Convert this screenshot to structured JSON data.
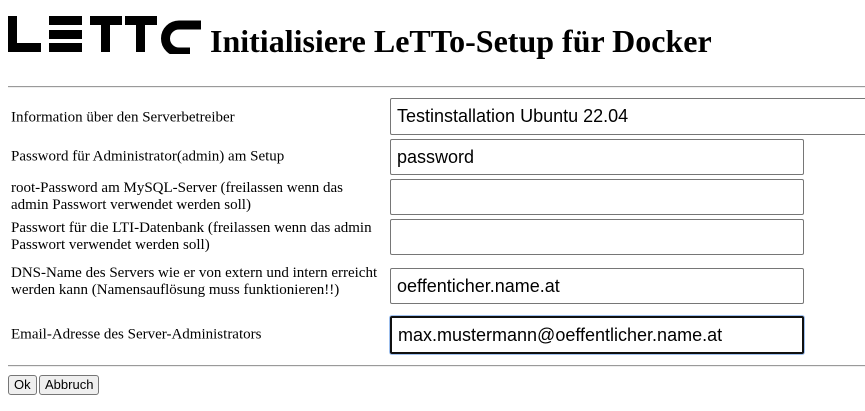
{
  "header": {
    "logo_text": "LeTTo",
    "title": "Initialisiere LeTTo-Setup für Docker"
  },
  "form": {
    "rows": [
      {
        "label": "Information über den Serverbetreiber",
        "value": "Testinstallation Ubuntu 22.04"
      },
      {
        "label": "Password für Administrator(admin) am Setup",
        "value": "password"
      },
      {
        "label": "root-Password am MySQL-Server (freilassen wenn das admin Passwort verwendet werden soll)",
        "value": ""
      },
      {
        "label": "Passwort für die LTI-Datenbank (freilassen wenn das admin Passwort verwendet werden soll)",
        "value": ""
      },
      {
        "label": "DNS-Name des Servers wie er von extern und intern erreicht werden kann (Namensauflösung muss funktionieren!!)",
        "value": "oeffenticher.name.at"
      },
      {
        "label": "Email-Adresse des Server-Administrators",
        "value": "max.mustermann@oeffentlicher.name.at"
      }
    ]
  },
  "buttons": {
    "ok_label": "Ok",
    "cancel_label": "Abbruch"
  }
}
